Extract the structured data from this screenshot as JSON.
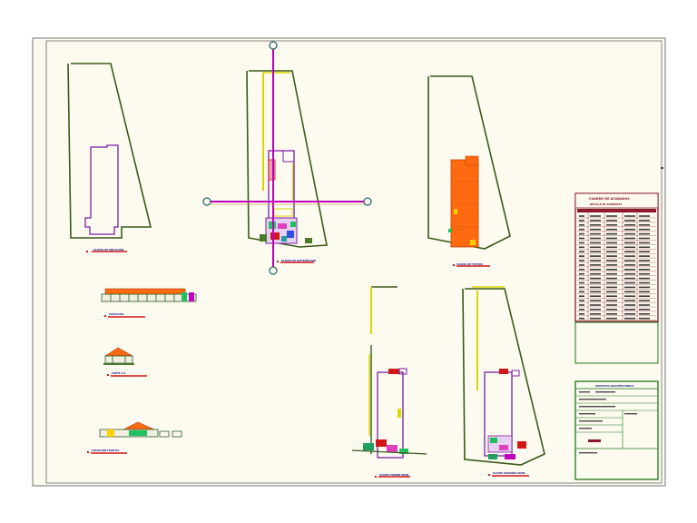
{
  "drawing": {
    "labels": {
      "plan_1": "PLANTA DE UBICACIÓN",
      "plan_2": "PLANTA DE DISTRIBUCIÓN",
      "plan_3": "PLANTA DE TECHOS",
      "elevation_1": "ELEVACIÓN",
      "elevation_2": "CORTE A-A",
      "elevation_3": "ELEVACIÓN FRONTAL",
      "plan_4": "PLANTA PRIMER NIVEL",
      "plan_5": "PLANTA SEGUNDO NIVEL"
    },
    "schedule": {
      "title": "CUADRO DE ACABADOS",
      "subtitle": "DETALLE DE AMBIENTES"
    },
    "title_block": {
      "header": "PROYECTO ARQUITECTÓNICO"
    }
  },
  "colors": {
    "paper": "#fdfaf0",
    "site_boundary": "#3a5a1a",
    "walls": "#7a1fa2",
    "axis": "#c000c0",
    "accent_yellow": "#d8d800",
    "roof": "#ff6a10",
    "frame": "#7a7a7a",
    "table_border": "#8b1a2a",
    "title_block_border": "#1a7a1a",
    "label_red": "#d01818"
  }
}
